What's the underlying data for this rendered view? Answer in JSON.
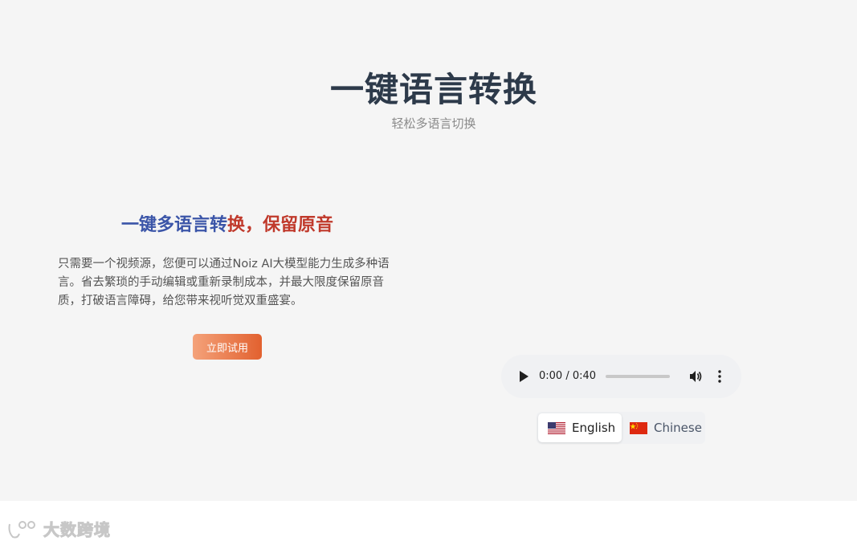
{
  "header": {
    "title": "一键语言转换",
    "subtitle": "轻松多语言切换"
  },
  "feature": {
    "title_part1": "一键多语言转",
    "title_part2": "换，保留原音",
    "description": "只需要一个视频源，您便可以通过Noiz AI大模型能力生成多种语言。省去繁琐的手动编辑或重新录制成本，并最大限度保留原音质，打破语言障碍，给您带来视听觉双重盛宴。",
    "cta_label": "立即试用",
    "cta_colors": [
      "#f4a27a",
      "#e2612f"
    ]
  },
  "audio_player": {
    "time": "0:00 / 0:40",
    "progress": 0
  },
  "language_toggle": {
    "options": [
      {
        "label": "English",
        "flag": "us-flag-icon",
        "selected": true
      },
      {
        "label": "Chinese",
        "flag": "cn-flag-icon",
        "selected": false
      }
    ]
  },
  "watermark": {
    "text": "大数跨境"
  },
  "colors": {
    "title": "#2d3a4a",
    "feature_blue": "#3b55a8",
    "feature_red": "#c0392b",
    "section_bg": "#f5f5f5"
  }
}
